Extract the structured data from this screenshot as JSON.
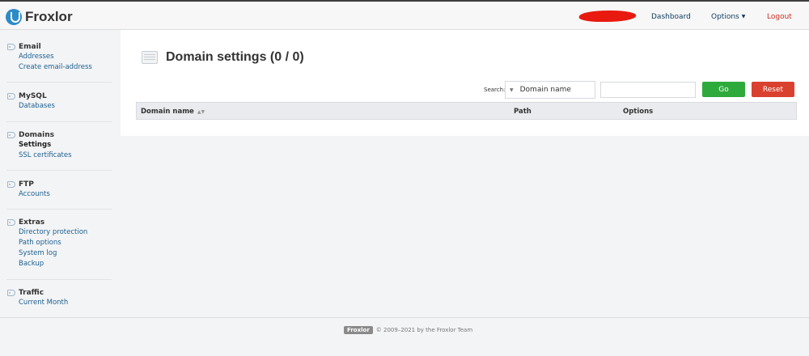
{
  "header": {
    "logo_text": "Froxlor",
    "nav": {
      "dashboard": "Dashboard",
      "options": "Options",
      "logout": "Logout"
    }
  },
  "sidebar": {
    "groups": [
      {
        "title": "Email",
        "items": [
          {
            "label": "Addresses"
          },
          {
            "label": "Create email-address"
          }
        ]
      },
      {
        "title": "MySQL",
        "items": [
          {
            "label": "Databases"
          }
        ]
      },
      {
        "title": "Domains",
        "items": [
          {
            "label": "Settings",
            "active": true
          },
          {
            "label": "SSL certificates"
          }
        ]
      },
      {
        "title": "FTP",
        "items": [
          {
            "label": "Accounts"
          }
        ]
      },
      {
        "title": "Extras",
        "items": [
          {
            "label": "Directory protection"
          },
          {
            "label": "Path options"
          },
          {
            "label": "System log"
          },
          {
            "label": "Backup"
          }
        ]
      },
      {
        "title": "Traffic",
        "items": [
          {
            "label": "Current Month"
          }
        ]
      }
    ]
  },
  "main": {
    "title": "Domain settings (0 / 0)",
    "search": {
      "label": "Search:",
      "field_selected": "Domain name",
      "value": "",
      "go_label": "Go",
      "reset_label": "Reset"
    },
    "table": {
      "columns": [
        "Domain name",
        "Path",
        "Options"
      ],
      "rows": []
    }
  },
  "footer": {
    "logo_text": "Froxlor",
    "copyright": "© 2009–2021 by the Froxlor Team"
  },
  "colors": {
    "accent": "#2d8bc6",
    "go": "#2eaa3c",
    "reset": "#d9402e",
    "logout": "#c7301f"
  }
}
